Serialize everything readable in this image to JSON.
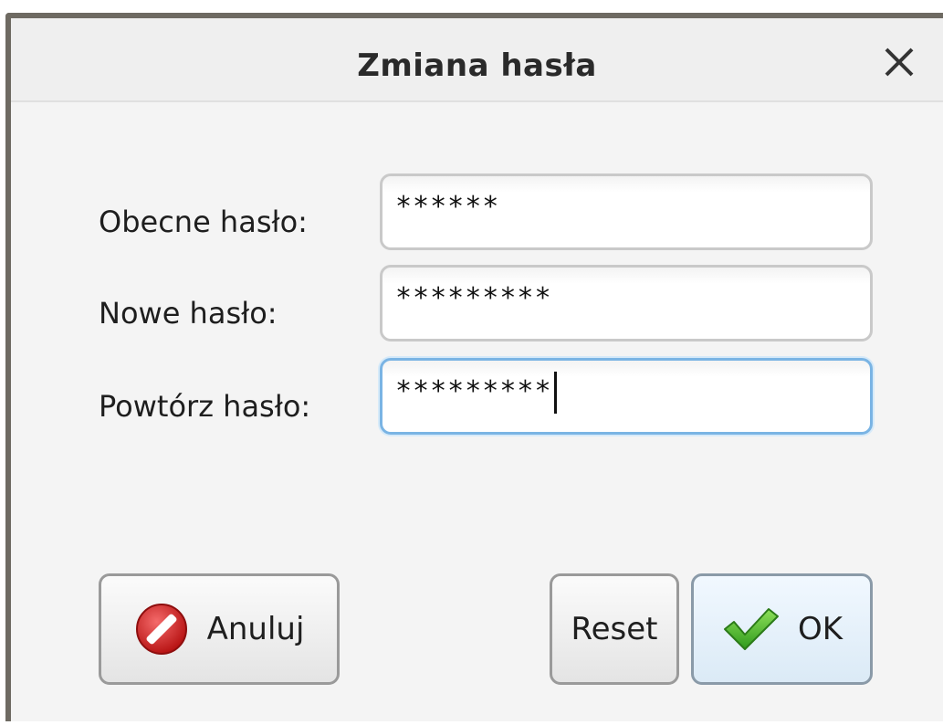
{
  "dialog": {
    "title": "Zmiana hasła"
  },
  "form": {
    "current_password": {
      "label": "Obecne hasło:",
      "value": "******"
    },
    "new_password": {
      "label": "Nowe hasło:",
      "value": "*********"
    },
    "repeat_password": {
      "label": "Powtórz hasło:",
      "value": "*********"
    }
  },
  "buttons": {
    "cancel_label": "Anuluj",
    "reset_label": "Reset",
    "ok_label": "OK"
  },
  "icons": {
    "close": "close-icon",
    "cancel": "no-entry-icon",
    "ok": "checkmark-icon"
  },
  "colors": {
    "focus_border": "#7ab4e4",
    "cancel_icon": "#d42a2a",
    "ok_icon": "#4caf2e"
  }
}
